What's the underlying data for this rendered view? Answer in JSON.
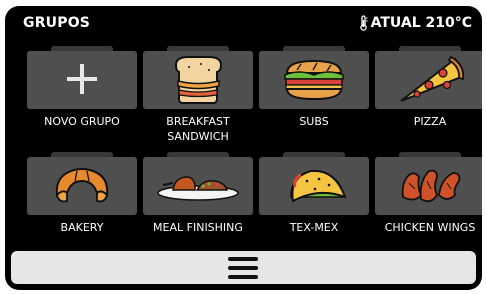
{
  "header": {
    "title": "GRUPOS",
    "temperature": "ATUAL 210°C",
    "thermometer_icon": "thermometer-icon"
  },
  "groups": [
    {
      "label": "NOVO GRUPO",
      "icon": "plus-icon"
    },
    {
      "label": "BREAKFAST SANDWICH",
      "icon": "sandwich-icon"
    },
    {
      "label": "SUBS",
      "icon": "sub-sandwich-icon"
    },
    {
      "label": "PIZZA",
      "icon": "pizza-slice-icon"
    },
    {
      "label": "BAKERY",
      "icon": "croissant-icon"
    },
    {
      "label": "MEAL FINISHING",
      "icon": "meal-plate-icon"
    },
    {
      "label": "TEX-MEX",
      "icon": "taco-icon"
    },
    {
      "label": "CHICKEN WINGS",
      "icon": "chicken-wings-icon"
    }
  ],
  "bottom_bar": {
    "menu_icon": "hamburger-menu-icon"
  },
  "colors": {
    "background": "#000000",
    "folder": "#4f4f4f",
    "bar": "#e6e6e6"
  }
}
